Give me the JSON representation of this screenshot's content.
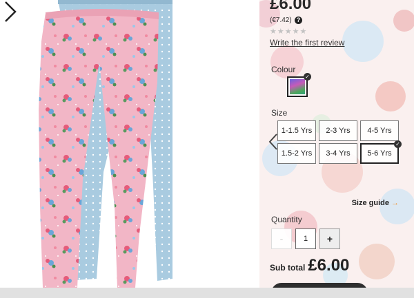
{
  "product": {
    "price": "£6.00",
    "price_eur": "(€7.42)",
    "rating_stars": "★★★★★",
    "write_review": "Write the first review"
  },
  "colour": {
    "label": "Colour",
    "selected": "multicolour floral swatch"
  },
  "size": {
    "label": "Size",
    "options": [
      "1-1.5 Yrs",
      "2-3 Yrs",
      "4-5 Yrs",
      "1.5-2 Yrs",
      "3-4 Yrs",
      "5-6 Yrs"
    ],
    "selected": "5-6 Yrs",
    "guide_label": "Size guide",
    "guide_arrow": "→"
  },
  "quantity": {
    "label": "Quantity",
    "value": "1",
    "minus": "-",
    "plus": "+"
  },
  "subtotal": {
    "label": "Sub total",
    "amount": "£6.00"
  },
  "colors": {
    "accent": "#f0902a",
    "dark": "#2e2e2e",
    "legging_pink": "#f2b6c6",
    "legging_blue": "#a9cbe0"
  },
  "icons": [
    "next-arrow-icon",
    "prev-arrow-icon",
    "help-icon",
    "check-icon"
  ]
}
